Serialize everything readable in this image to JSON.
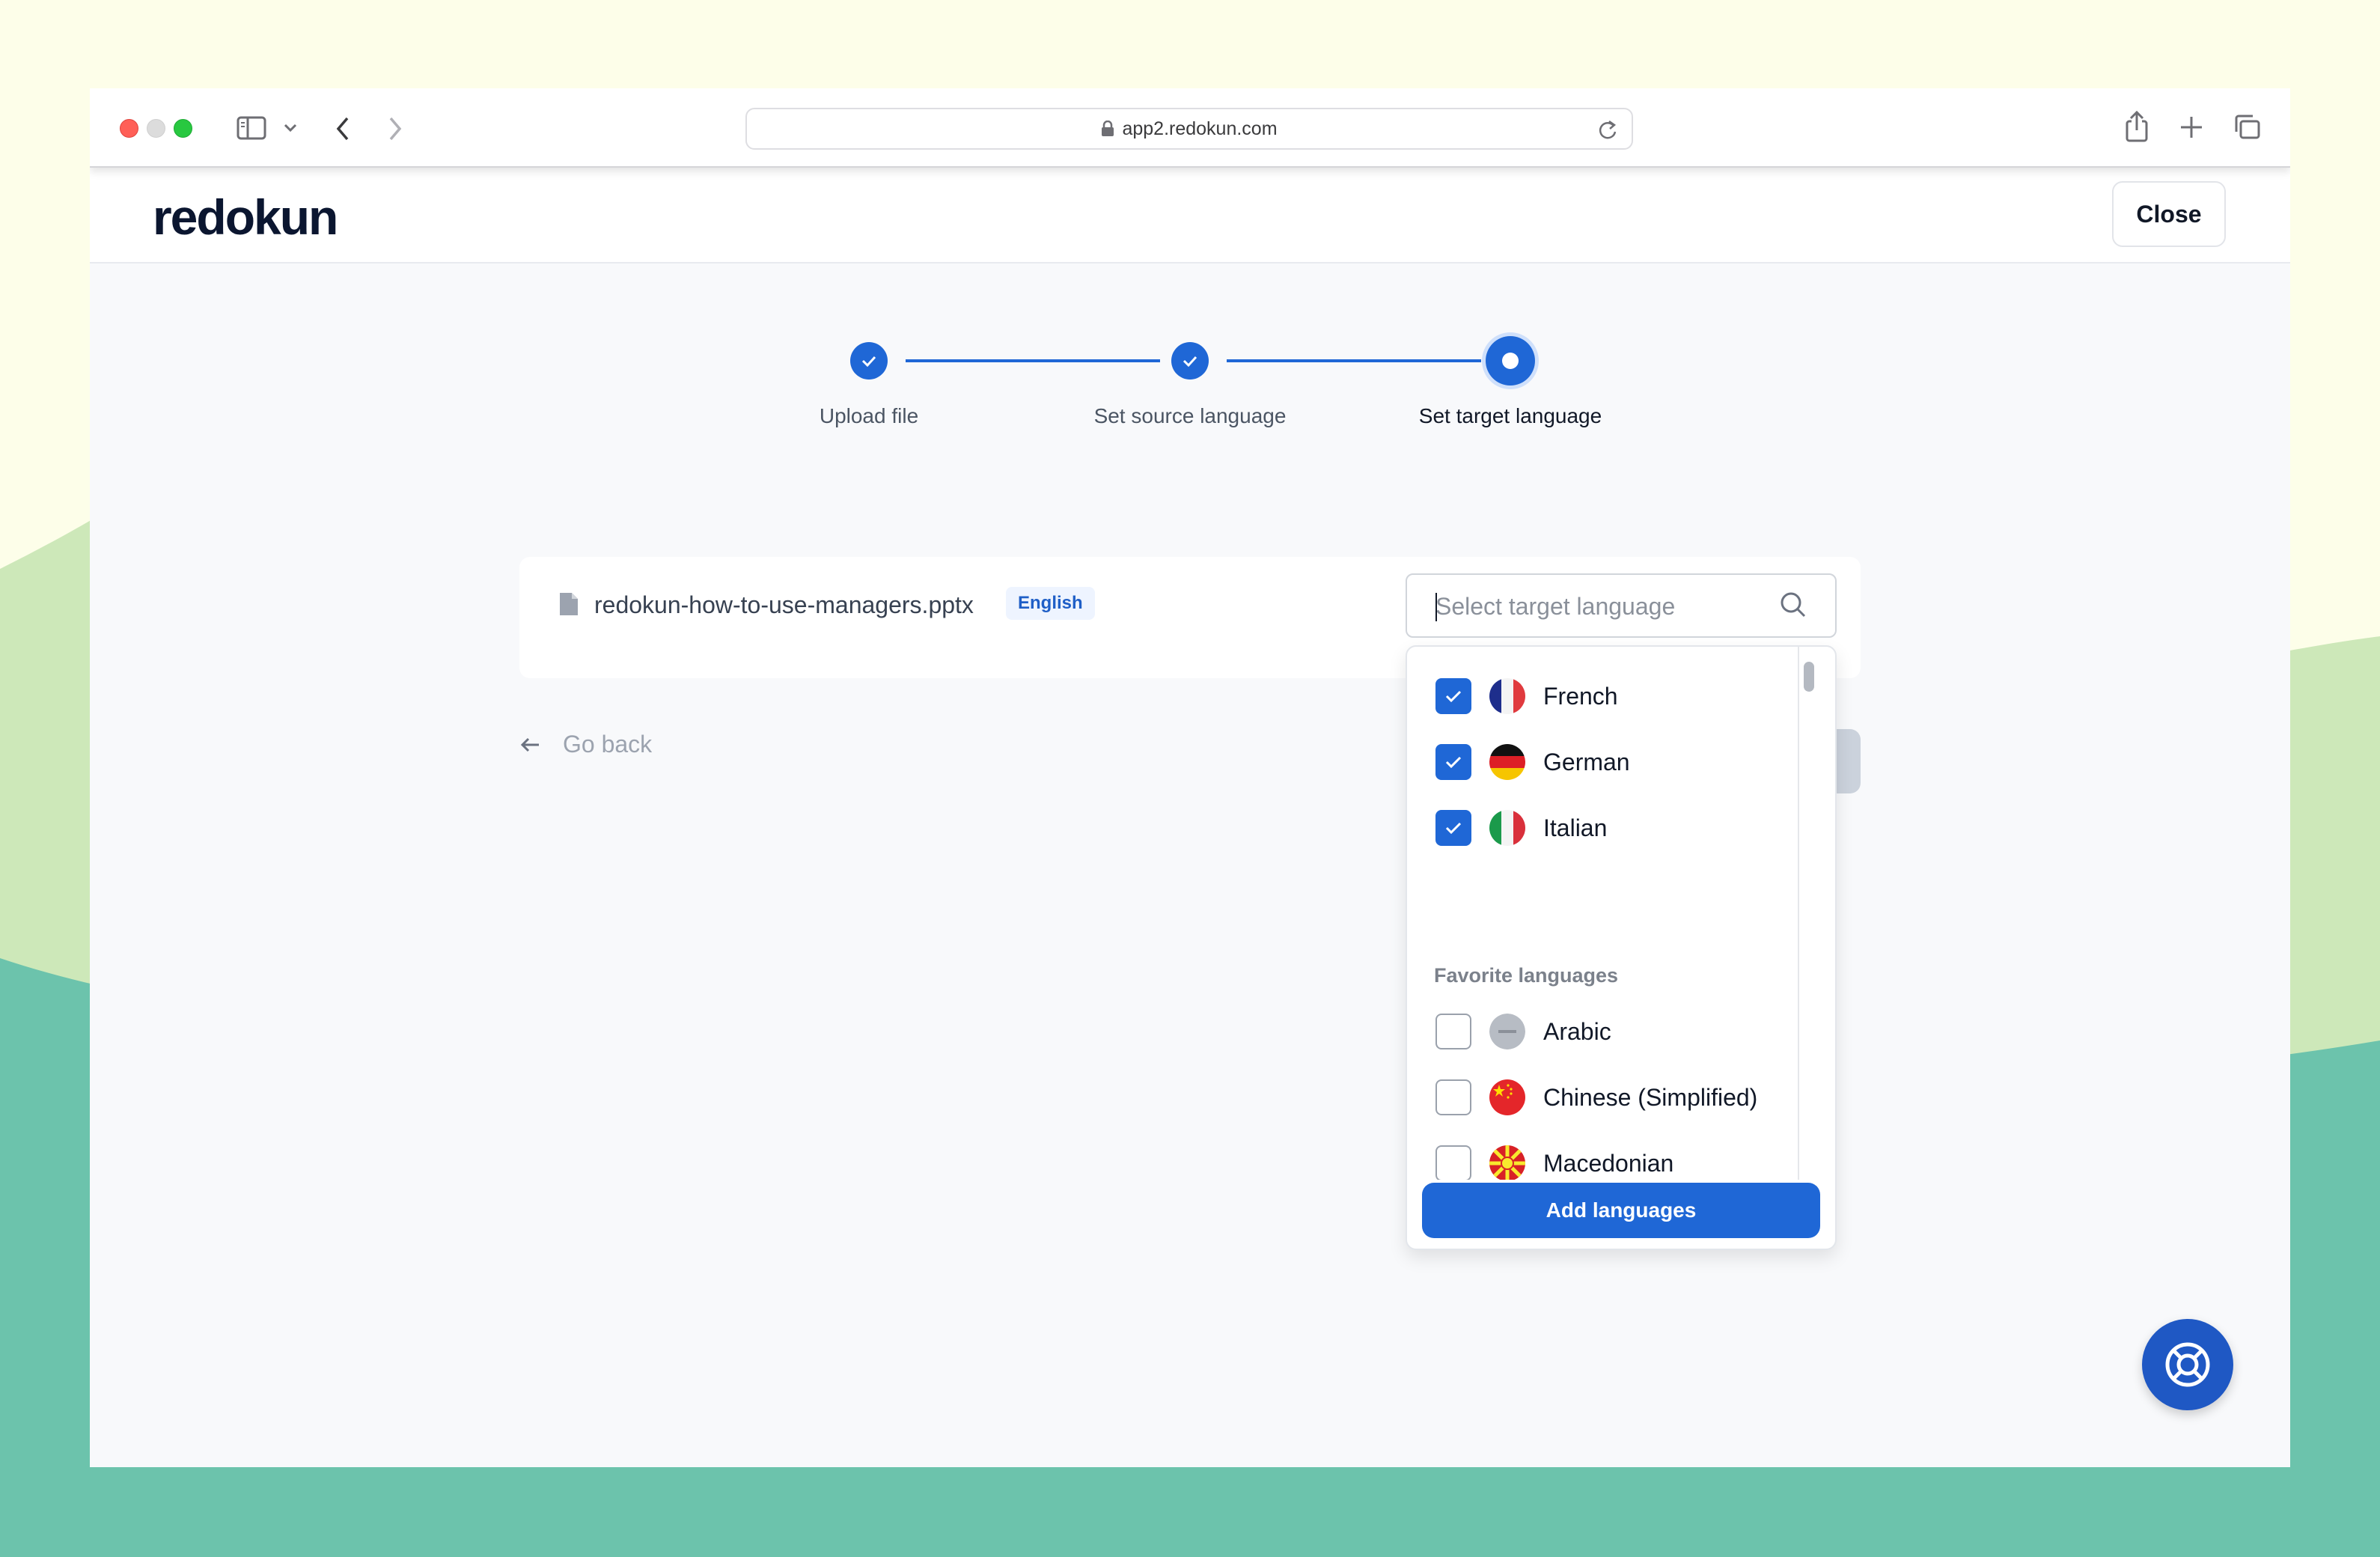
{
  "browser": {
    "url": "app2.redokun.com"
  },
  "app": {
    "logo": "redokun",
    "close_label": "Close"
  },
  "stepper": {
    "steps": [
      {
        "label": "Upload file",
        "state": "done"
      },
      {
        "label": "Set source language",
        "state": "done"
      },
      {
        "label": "Set target language",
        "state": "current"
      }
    ]
  },
  "file": {
    "name": "redokun-how-to-use-managers.pptx",
    "source_language": "English"
  },
  "search": {
    "placeholder": "Select target language",
    "value": ""
  },
  "dropdown": {
    "selected": [
      {
        "label": "French",
        "checked": true,
        "flag": "france-flag-icon"
      },
      {
        "label": "German",
        "checked": true,
        "flag": "germany-flag-icon"
      },
      {
        "label": "Italian",
        "checked": true,
        "flag": "italy-flag-icon"
      }
    ],
    "favorites_heading": "Favorite languages",
    "favorites": [
      {
        "label": "Arabic",
        "checked": false,
        "flag": "generic-flag-icon"
      },
      {
        "label": "Chinese (Simplified)",
        "checked": false,
        "flag": "china-flag-icon"
      },
      {
        "label": "Macedonian",
        "checked": false,
        "flag": "macedonia-flag-icon"
      }
    ],
    "add_button_label": "Add languages"
  },
  "nav": {
    "go_back_label": "Go back"
  },
  "colors": {
    "accent": "#1f67d6",
    "help_button": "#1f58c4"
  }
}
